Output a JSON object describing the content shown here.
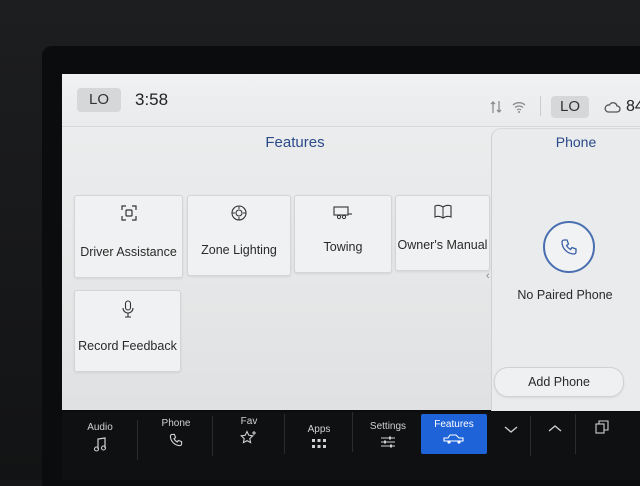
{
  "header": {
    "left_temp": "LO",
    "time": "3:58",
    "right_temp": "LO",
    "outside_temp": "84"
  },
  "features": {
    "title": "Features",
    "tiles": [
      {
        "label": "Driver Assistance",
        "icon": "driver-assist-icon"
      },
      {
        "label": "Zone Lighting",
        "icon": "zone-lighting-icon"
      },
      {
        "label": "Towing",
        "icon": "trailer-icon"
      },
      {
        "label": "Owner's Manual",
        "icon": "book-icon"
      },
      {
        "label": "Record Feedback",
        "icon": "microphone-icon"
      }
    ]
  },
  "phone": {
    "title": "Phone",
    "status": "No Paired Phone",
    "add_label": "Add Phone"
  },
  "nav": {
    "items": [
      {
        "label": "Audio",
        "icon": "music-note-icon"
      },
      {
        "label": "Phone",
        "icon": "phone-icon"
      },
      {
        "label": "Fav",
        "icon": "star-plus-icon"
      },
      {
        "label": "Apps",
        "icon": "grid-icon"
      },
      {
        "label": "Settings",
        "icon": "sliders-icon"
      },
      {
        "label": "Features",
        "icon": "truck-icon"
      }
    ],
    "active": "Features"
  },
  "colors": {
    "accent": "#1f63d8",
    "title_blue": "#2b4a8a",
    "phone_ring": "#4a6fb0"
  }
}
